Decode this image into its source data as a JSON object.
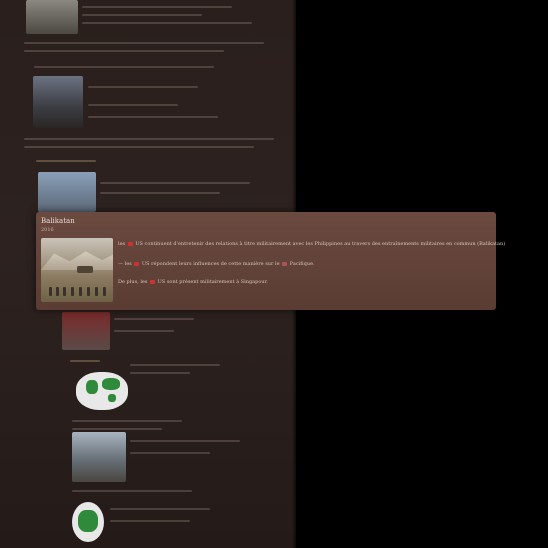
{
  "popup": {
    "title": "Balikatan",
    "year": "2016",
    "lines": [
      {
        "prefix": "les",
        "text": "US continuent d'entretenir des relations à titre militairement avec les Philippines au travers des entraînements militaires en commun (Balikatan)"
      },
      {
        "prefix": "— les",
        "text": "US répondent leurs influences de cette manière sur le",
        "suffix": "Pacifique."
      },
      {
        "prefix": "De plus, les",
        "text": "US sont présent militairement à Singapour."
      }
    ]
  },
  "colors": {
    "background": "#000000",
    "panel": "#2d2220",
    "popup": "#5f4137",
    "popup_text": "#d7c6bd"
  },
  "icons": [
    "us-flag-icon",
    "globe-icon",
    "world-map-icon"
  ]
}
